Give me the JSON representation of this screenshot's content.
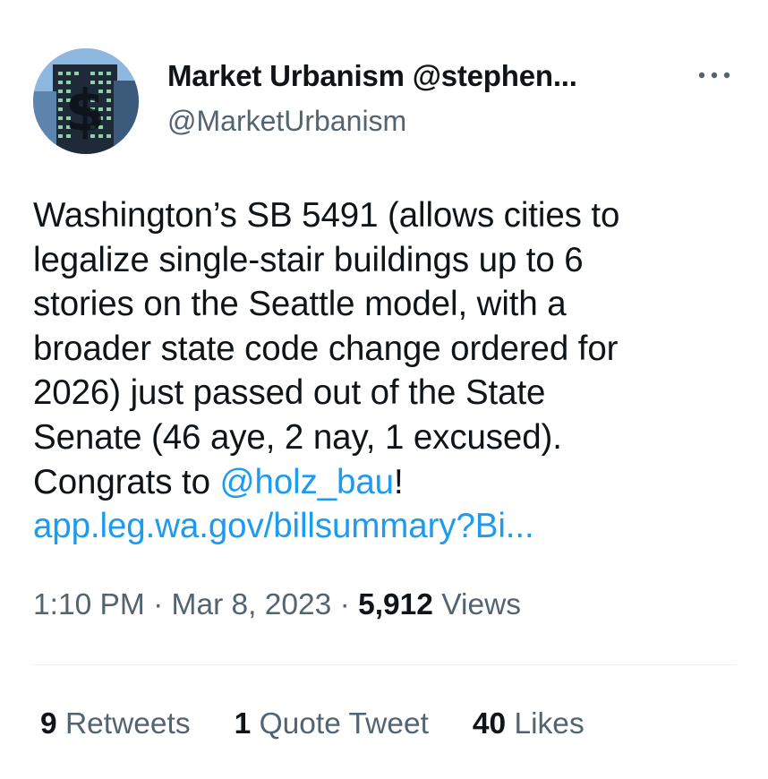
{
  "author": {
    "display_name": "Market Urbanism @stephen...",
    "handle": "@MarketUrbanism",
    "avatar_icon": "building-dollar-avatar"
  },
  "more_icon": "more-horizontal-icon",
  "tweet": {
    "lines": [
      "Washington’s SB 5491 (allows cities to",
      "legalize single-stair buildings up to 6",
      "stories on the Seattle model, with a",
      "broader state code change ordered for",
      "2026) just passed out of the State",
      "Senate (46 aye, 2 nay, 1 excused)."
    ],
    "congrats_prefix": "Congrats to ",
    "mention": "@holz_bau",
    "congrats_suffix": "!",
    "url": "app.leg.wa.gov/billsummary?Bi..."
  },
  "meta": {
    "time": "1:10 PM",
    "separator": "·",
    "date": "Mar 8, 2023",
    "views_count": "5,912",
    "views_label": "Views"
  },
  "stats": {
    "retweets_count": "9",
    "retweets_label": "Retweets",
    "quotes_count": "1",
    "quotes_label": "Quote Tweet",
    "likes_count": "40",
    "likes_label": "Likes"
  },
  "colors": {
    "link": "#1d9bf0",
    "primary_text": "#0f1419",
    "secondary_text": "#536471",
    "divider": "#eff3f4"
  }
}
